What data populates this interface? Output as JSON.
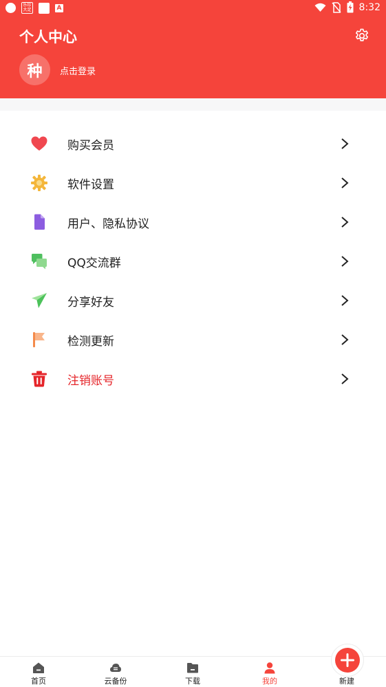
{
  "status_bar": {
    "time": "8:32",
    "notif_icon_text": "乐珍大足"
  },
  "header": {
    "title": "个人中心",
    "avatar_char": "种",
    "login_text": "点击登录",
    "background": "#f5443b"
  },
  "menu": {
    "items": [
      {
        "label": "购买会员",
        "icon": "heart-icon"
      },
      {
        "label": "软件设置",
        "icon": "sun-gear-icon"
      },
      {
        "label": "用户、隐私协议",
        "icon": "document-icon"
      },
      {
        "label": "QQ交流群",
        "icon": "chat-icon"
      },
      {
        "label": "分享好友",
        "icon": "paper-plane-icon"
      },
      {
        "label": "检测更新",
        "icon": "flag-icon"
      },
      {
        "label": "注销账号",
        "icon": "trash-icon",
        "danger_color": "#e5252a"
      }
    ]
  },
  "tabbar": {
    "tabs": [
      {
        "label": "首页",
        "icon": "home-icon"
      },
      {
        "label": "云备份",
        "icon": "cloud-icon"
      },
      {
        "label": "下载",
        "icon": "folder-icon"
      },
      {
        "label": "我的",
        "icon": "user-icon",
        "active": true
      },
      {
        "label": "新建",
        "icon": "plus-icon"
      }
    ],
    "active_color": "#f5443b"
  }
}
